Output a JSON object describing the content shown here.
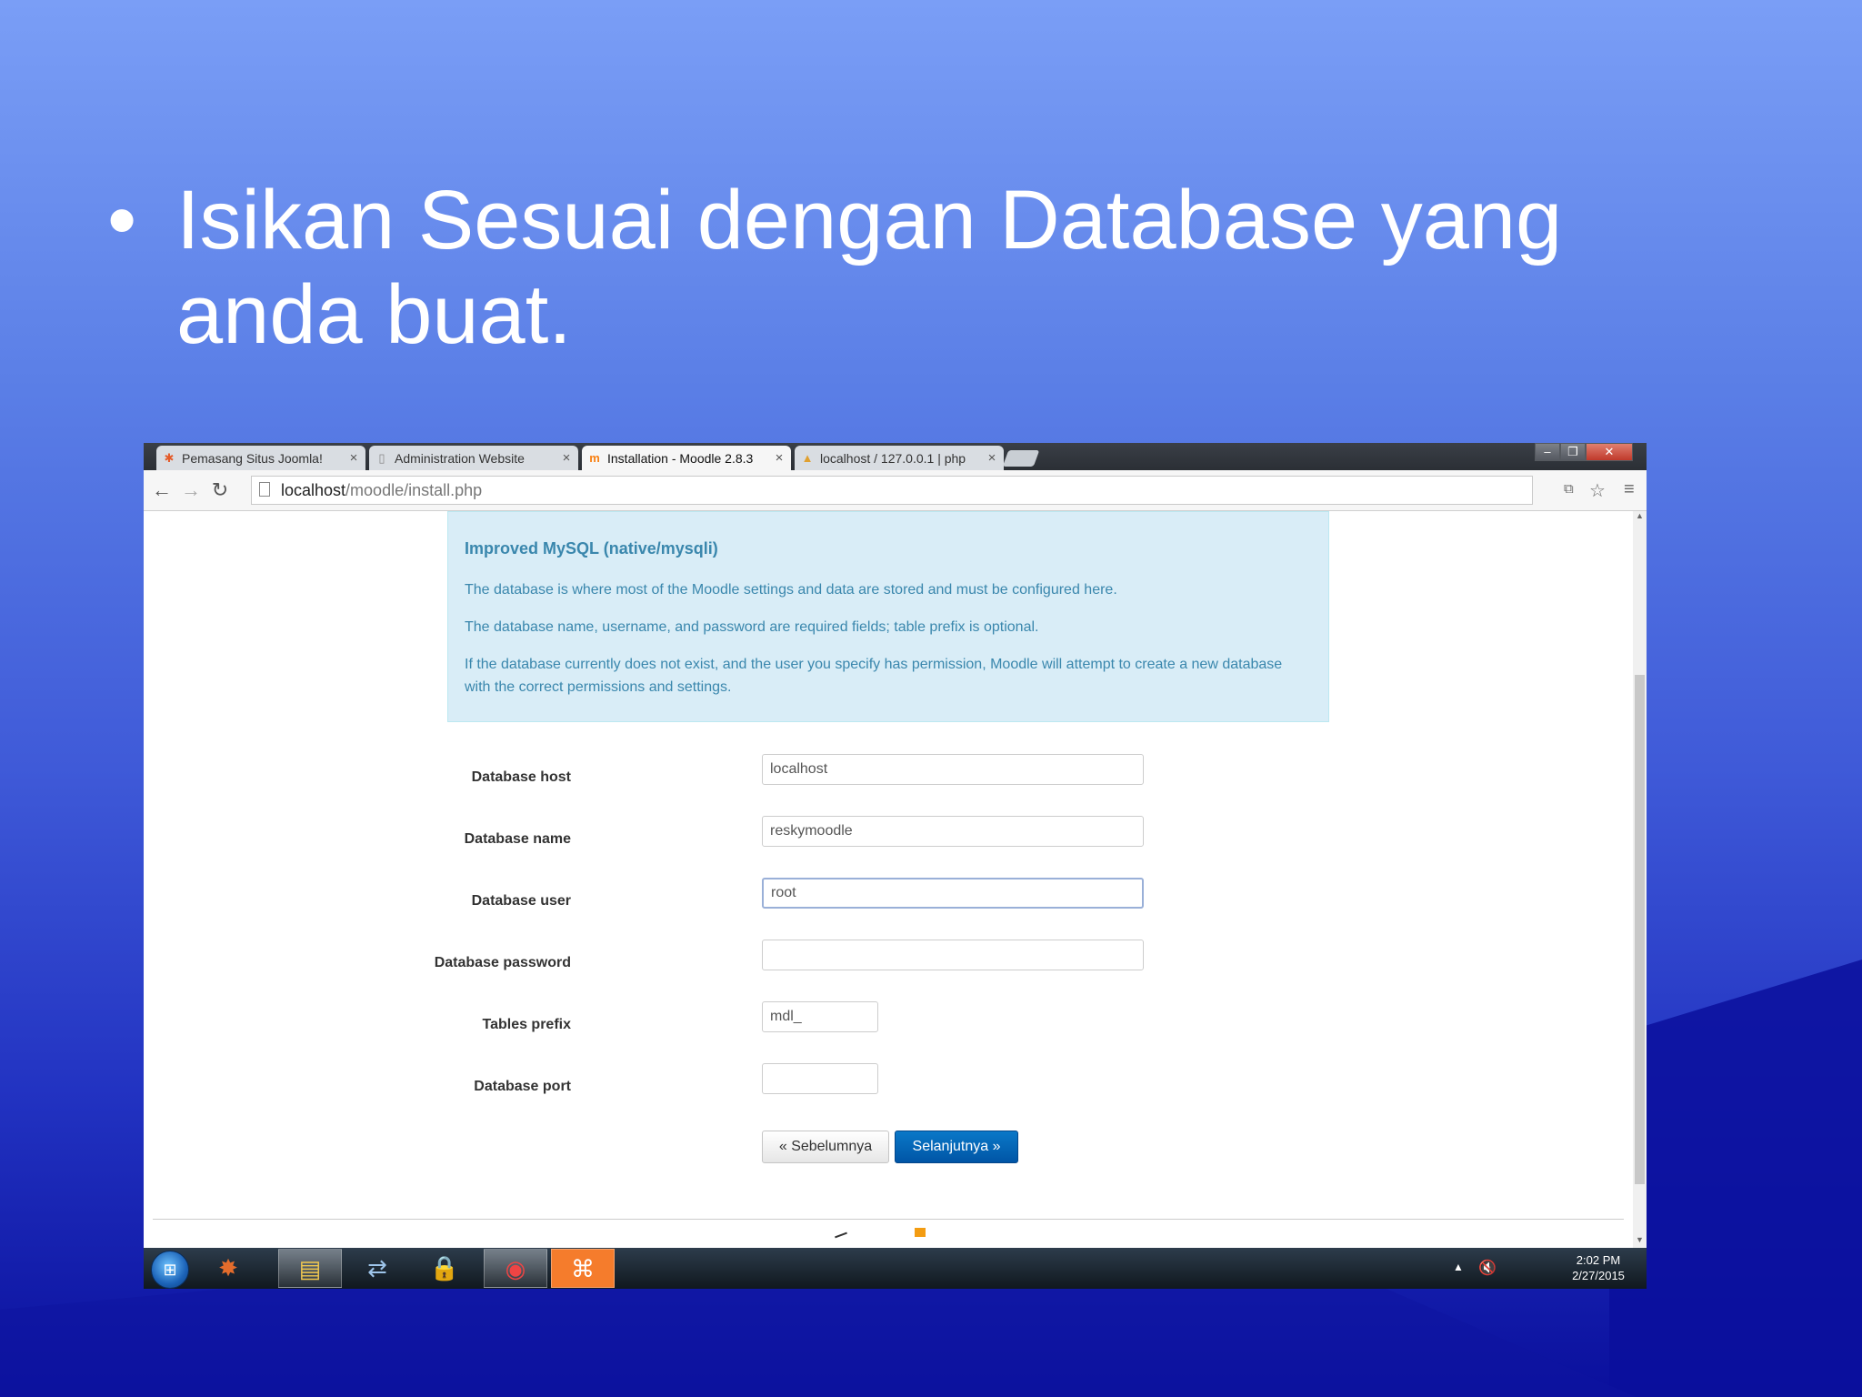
{
  "slide": {
    "bullet": "•",
    "text_line1": "Isikan Sesuai dengan Database yang",
    "text_line2": "anda buat."
  },
  "browser": {
    "tabs": [
      {
        "label": "Pemasang Situs Joomla!",
        "icon": "joomla-icon",
        "close": "×"
      },
      {
        "label": "Administration Website",
        "icon": "page-icon",
        "close": "×"
      },
      {
        "label": "Installation - Moodle 2.8.3",
        "icon": "moodle-icon",
        "close": "×"
      },
      {
        "label": "localhost / 127.0.0.1 | php",
        "icon": "phpmyadmin-icon",
        "close": "×"
      }
    ],
    "url_host": "localhost",
    "url_path": "/moodle/install.php"
  },
  "page": {
    "info_title": "Improved MySQL (native/mysqli)",
    "info_p1": "The database is where most of the Moodle settings and data are stored and must be configured here.",
    "info_p2": "The database name, username, and password are required fields; table prefix is optional.",
    "info_p3": "If the database currently does not exist, and the user you specify has permission, Moodle will attempt to create a new database with the correct permissions and settings.",
    "fields": {
      "dbhost": {
        "label": "Database host",
        "value": "localhost"
      },
      "dbname": {
        "label": "Database name",
        "value": "reskymoodle"
      },
      "dbuser": {
        "label": "Database user",
        "value": "root"
      },
      "dbpass": {
        "label": "Database password",
        "value": ""
      },
      "prefix": {
        "label": "Tables prefix",
        "value": "mdl_"
      },
      "dbport": {
        "label": "Database port",
        "value": ""
      }
    },
    "prev_button": "« Sebelumnya",
    "next_button": "Selanjutnya »"
  },
  "taskbar": {
    "time": "2:02 PM",
    "date": "2/27/2015"
  },
  "colors": {
    "info_bg": "#d9edf7",
    "info_text": "#3a87ad",
    "primary_button": "#0061b3"
  }
}
